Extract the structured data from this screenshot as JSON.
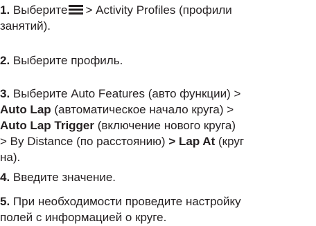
{
  "steps": [
    {
      "number": "1.",
      "text_before_icon": "Выберите",
      "icon": "menu-icon",
      "text_after_icon": "> Activity Profiles (профили",
      "line2": "занятий)."
    },
    {
      "number": "2.",
      "text": "Выберите профиль."
    },
    {
      "number": "3.",
      "line1": "Выберите Auto Features (авто функции) >",
      "line2_bold": "Auto Lap",
      "line2_rest": "(автоматическое начало круга) >",
      "line3_bold": "Auto Lap Trigger",
      "line3_rest": "(включение нового круга)",
      "line4_plain": "> By Distance (по расстоянию)",
      "line4_bold": "> Lap At",
      "line4_rest": "(круг",
      "line5": "на)."
    },
    {
      "number": "4.",
      "text": "Введите значение."
    },
    {
      "number": "5.",
      "line1": "При необходимости проведите настройку",
      "line2": "полей с информацией о круге."
    }
  ]
}
